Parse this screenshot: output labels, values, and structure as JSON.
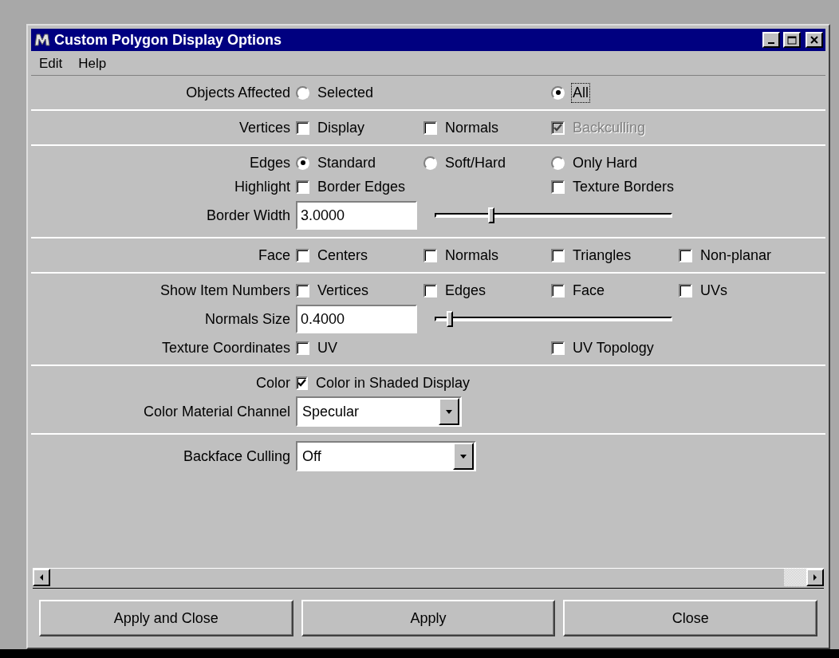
{
  "window": {
    "title": "Custom Polygon Display Options"
  },
  "menu": [
    "Edit",
    "Help"
  ],
  "sections": [
    {
      "rows": [
        {
          "label": "Objects Affected",
          "kind": "radio",
          "items": [
            {
              "label": "Selected",
              "selected": false,
              "focused": false
            },
            {
              "label": "All",
              "selected": true,
              "focused": true
            }
          ]
        }
      ]
    },
    {
      "rows": [
        {
          "label": "Vertices",
          "kind": "check",
          "items": [
            {
              "label": "Display",
              "checked": false,
              "disabled": false
            },
            {
              "label": "Normals",
              "checked": false,
              "disabled": false
            },
            {
              "label": "Backculling",
              "checked": true,
              "disabled": true
            }
          ]
        }
      ]
    },
    {
      "rows": [
        {
          "label": "Edges",
          "kind": "radio",
          "items": [
            {
              "label": "Standard",
              "selected": true,
              "focused": false
            },
            {
              "label": "Soft/Hard",
              "selected": false,
              "focused": false
            },
            {
              "label": "Only Hard",
              "selected": false,
              "focused": false
            }
          ]
        },
        {
          "label": "Highlight",
          "kind": "check",
          "items": [
            {
              "label": "Border Edges",
              "checked": false,
              "disabled": false
            },
            {
              "label": "Texture Borders",
              "checked": false,
              "disabled": false
            }
          ]
        },
        {
          "label": "Border Width",
          "kind": "slider",
          "value": "3.0000",
          "level": 0.23
        }
      ]
    },
    {
      "rows": [
        {
          "label": "Face",
          "kind": "check",
          "items": [
            {
              "label": "Centers",
              "checked": false,
              "disabled": false
            },
            {
              "label": "Normals",
              "checked": false,
              "disabled": false
            },
            {
              "label": "Triangles",
              "checked": false,
              "disabled": false
            },
            {
              "label": "Non-planar",
              "checked": false,
              "disabled": false
            }
          ]
        }
      ]
    },
    {
      "rows": [
        {
          "label": "Show Item Numbers",
          "kind": "check",
          "items": [
            {
              "label": "Vertices",
              "checked": false,
              "disabled": false
            },
            {
              "label": "Edges",
              "checked": false,
              "disabled": false
            },
            {
              "label": "Face",
              "checked": false,
              "disabled": false
            },
            {
              "label": "UVs",
              "checked": false,
              "disabled": false
            }
          ]
        },
        {
          "label": "Normals Size",
          "kind": "slider",
          "value": "0.4000",
          "level": 0.05
        },
        {
          "label": "Texture Coordinates",
          "kind": "check",
          "items": [
            {
              "label": "UV",
              "checked": false,
              "disabled": false
            },
            {
              "label": "UV Topology",
              "checked": false,
              "disabled": false
            }
          ]
        }
      ]
    },
    {
      "rows": [
        {
          "label": "Color",
          "kind": "check",
          "items": [
            {
              "label": "Color in Shaded Display",
              "checked": true,
              "disabled": false
            }
          ]
        },
        {
          "label": "Color Material Channel",
          "kind": "dropdown",
          "value": "Specular"
        }
      ]
    },
    {
      "rows": [
        {
          "label": "Backface Culling",
          "kind": "dropdown",
          "value": "Off"
        }
      ]
    }
  ],
  "buttons": [
    "Apply and Close",
    "Apply",
    "Close"
  ]
}
